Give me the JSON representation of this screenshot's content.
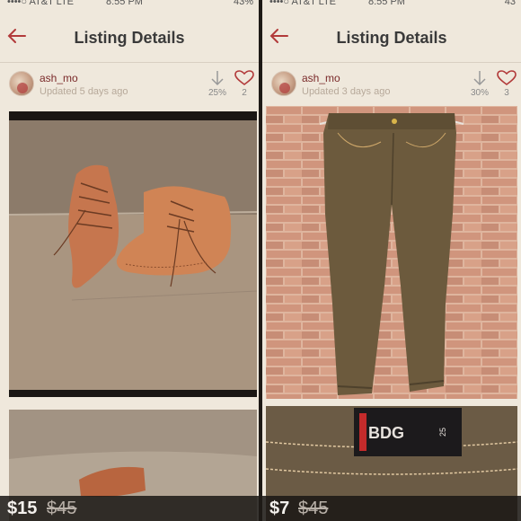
{
  "colors": {
    "accent": "#b23a3a",
    "panel_bg": "#efe8dc"
  },
  "listings": [
    {
      "status_bar": {
        "carrier": "••••○ AT&T  LTE",
        "time": "8:55 PM",
        "battery": "43%"
      },
      "nav": {
        "title": "Listing Details",
        "back_icon": "back-arrow-icon"
      },
      "seller": {
        "username": "ash_mo",
        "updated": "Updated 5 days ago"
      },
      "stats": {
        "discount": "25%",
        "likes": "2"
      },
      "photo_subject": "tan leather lace-up ankle boots",
      "price": {
        "current": "$15",
        "original": "$45"
      }
    },
    {
      "status_bar": {
        "carrier": "••••○ AT&T  LTE",
        "time": "8:55 PM",
        "battery": "43"
      },
      "nav": {
        "title": "Listing Details",
        "back_icon": "back-arrow-icon"
      },
      "seller": {
        "username": "ash_mo",
        "updated": "Updated 3 days ago"
      },
      "stats": {
        "discount": "30%",
        "likes": "3"
      },
      "photo_subject": "olive skinny jeans on brick wall",
      "label_text": {
        "brand": "BDG",
        "size": "25"
      },
      "price": {
        "current": "$7",
        "original": "$45"
      }
    }
  ]
}
